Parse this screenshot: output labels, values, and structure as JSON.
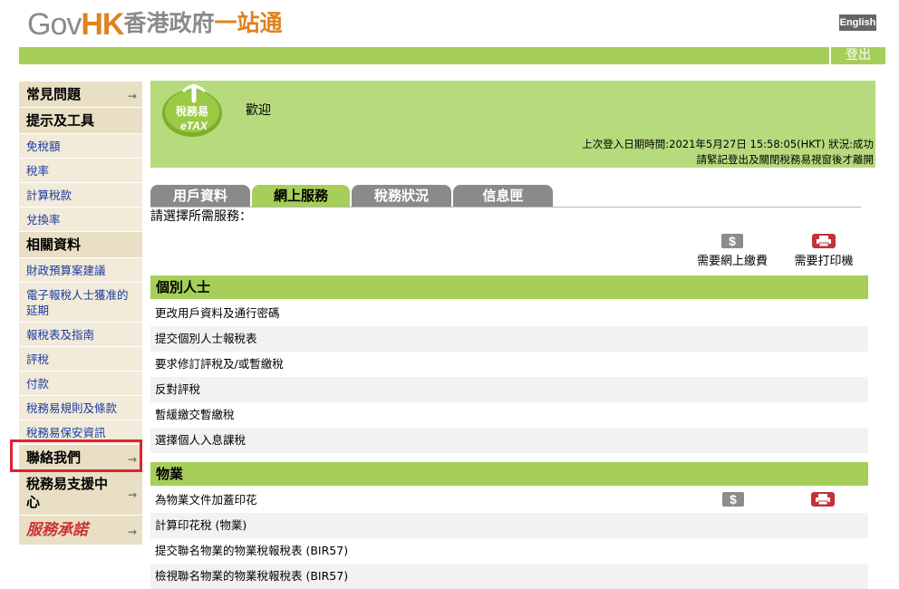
{
  "header": {
    "logo_gov": "Gov",
    "logo_hk": "HK",
    "logo_zh_gray": "香港政府",
    "logo_zh_orange": "一站通",
    "lang_button": "English",
    "logout_button": "登出"
  },
  "sidebar": {
    "items": [
      {
        "label": "常見問題",
        "type": "head",
        "arrow": true
      },
      {
        "label": "提示及工具",
        "type": "head",
        "arrow": false
      },
      {
        "label": "免稅額",
        "type": "sub"
      },
      {
        "label": "稅率",
        "type": "sub"
      },
      {
        "label": "計算稅款",
        "type": "sub"
      },
      {
        "label": "兌換率",
        "type": "sub"
      },
      {
        "label": "相關資料",
        "type": "head",
        "arrow": false
      },
      {
        "label": "財政預算案建議",
        "type": "sub"
      },
      {
        "label": "電子報稅人士獲准的延期",
        "type": "sub"
      },
      {
        "label": "報稅表及指南",
        "type": "sub"
      },
      {
        "label": "評稅",
        "type": "sub"
      },
      {
        "label": "付款",
        "type": "sub"
      },
      {
        "label": "稅務易規則及條款",
        "type": "sub"
      },
      {
        "label": "稅務易保安資訊",
        "type": "sub"
      },
      {
        "label": "聯絡我們",
        "type": "head",
        "arrow": true
      },
      {
        "label": "稅務易支援中心",
        "type": "head",
        "arrow": true
      },
      {
        "label": "服務承諾",
        "type": "seal",
        "arrow": true
      }
    ]
  },
  "banner": {
    "logo_zh": "稅務易",
    "logo_en": "eTAX",
    "welcome": "歡迎",
    "last_login": "上次登入日期時間:2021年5月27日 15:58:05(HKT) 狀況:成功",
    "reminder": "請緊記登出及關閉稅務易視窗後才離開"
  },
  "tabs": [
    {
      "label": "用戶資料",
      "active": false
    },
    {
      "label": "網上服務",
      "active": true
    },
    {
      "label": "稅務狀況",
      "active": false
    },
    {
      "label": "信息匣",
      "active": false
    }
  ],
  "prompt": "請選擇所需服務：",
  "legend": {
    "pay": "需要網上繳費",
    "print": "需要打印機"
  },
  "sections": [
    {
      "title": "個別人士",
      "rows": [
        {
          "label": "更改用戶資料及通行密碼",
          "pay": false,
          "print": false
        },
        {
          "label": "提交個別人士報稅表",
          "pay": false,
          "print": false
        },
        {
          "label": "要求修訂評稅及/或暫繳稅",
          "pay": false,
          "print": false
        },
        {
          "label": "反對評稅",
          "pay": false,
          "print": false
        },
        {
          "label": "暫緩繳交暫繳稅",
          "pay": false,
          "print": false
        },
        {
          "label": "選擇個人入息課稅",
          "pay": false,
          "print": false
        }
      ]
    },
    {
      "title": "物業",
      "rows": [
        {
          "label": "為物業文件加蓋印花",
          "pay": true,
          "print": true
        },
        {
          "label": "計算印花稅 (物業)",
          "pay": false,
          "print": false
        },
        {
          "label": "提交聯名物業的物業稅報稅表 (BIR57)",
          "pay": false,
          "print": false
        },
        {
          "label": "檢視聯名物業的物業稅報稅表 (BIR57)",
          "pay": false,
          "print": false
        }
      ]
    }
  ],
  "colors": {
    "accent_green": "#a6cf59",
    "banner_green": "#b7da7d",
    "sidebar_bg": "#f2ebda",
    "link_blue": "#1a3aa0",
    "highlight_red": "#e0232d",
    "logo_orange": "#e0821e"
  }
}
